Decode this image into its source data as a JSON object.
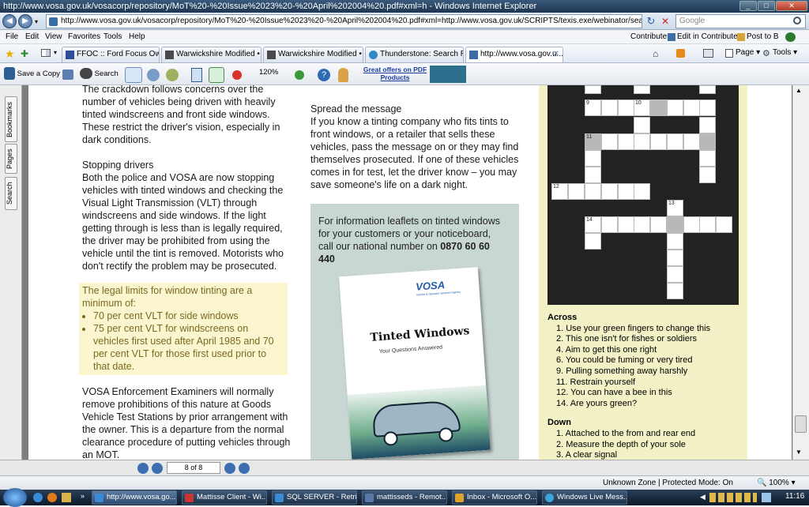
{
  "window": {
    "title": "http://www.vosa.gov.uk/vosacorp/repository/MoT%20-%20Issue%2023%20-%20April%202004%20.pdf#xml=h - Windows Internet Explorer",
    "min": "_",
    "max": "□",
    "close": "✕"
  },
  "address": {
    "url": "http://www.vosa.gov.uk/vosacorp/repository/MoT%20-%20Issue%2023%20-%20April%202004%20.pdf#xml=http://www.vosa.gov.uk/SCRIPTS/texis.exe/webinator/search/xml.txt?query=tints&p",
    "search_placeholder": "Google",
    "back": "◀",
    "forward": "▶",
    "refresh": "↻",
    "stop": "✕"
  },
  "menu": {
    "items": [
      "File",
      "Edit",
      "View",
      "Favorites",
      "Tools",
      "Help"
    ],
    "right": [
      "Contribute",
      "Edit in Contribute",
      "Post to Blo"
    ]
  },
  "tabs": [
    {
      "label": "FFOC :: Ford Focus Owner..."
    },
    {
      "label": "Warwickshire Modified • V..."
    },
    {
      "label": "Warwickshire Modified • V..."
    },
    {
      "label": "Thunderstone: Search Res..."
    },
    {
      "label": "http://www.vosa.gov.u..."
    }
  ],
  "tab_close": "✕",
  "cmd": {
    "page": "Page ▾",
    "tools": "Tools ▾"
  },
  "pdf_toolbar": {
    "save": "Save a Copy",
    "search": "Search",
    "zoom": "120%",
    "offer": "Great offers on PDF Products"
  },
  "left_tabs": [
    "Bookmarks",
    "Pages",
    "Search"
  ],
  "col1": {
    "p1": "The crackdown follows concerns over the number of vehicles being driven with heavily tinted windscreens and front side windows. These restrict the driver's vision, especially in dark conditions.",
    "h2": "Stopping drivers",
    "p2": "Both the police and VOSA are now stopping vehicles with tinted windows and checking the Visual Light Transmission (VLT) through windscreens and side windows. If the light getting through is less than is legally required, the driver may be prohibited from using the vehicle until the tint is removed. Motorists who don't rectify the problem may be prosecuted.",
    "legal_intro": "The legal limits for window tinting are a minimum of:",
    "legal_items": [
      "70 per cent VLT for side windows",
      "75 per cent VLT for windscreens on vehicles first used after April 1985 and 70 per cent VLT for those first used prior to that date."
    ],
    "p3": "VOSA Enforcement Examiners will normally remove prohibitions of this nature at Goods Vehicle Test Stations by prior arrangement with the owner. This is a departure from the normal clearance procedure of putting vehicles through an MOT."
  },
  "col2": {
    "h": "Spread the message",
    "p": "If you know a tinting company who fits tints to front windows, or a retailer that sells these vehicles, pass the message on or they may find themselves prosecuted. If one of these vehicles comes in for test, let the driver know – you may save someone's life on a dark night.",
    "info": "For information leaflets on tinted windows for your customers or your noticeboard, call our national number on",
    "phone": "0870 60 60 440",
    "leaflet_brand": "VOSA",
    "leaflet_brand_sub": "Vehicle & Operator Services Agency",
    "leaflet_title": "Tinted Windows",
    "leaflet_sub": "Your Questions Answered"
  },
  "col3": {
    "across_h": "Across",
    "across": [
      "1. Use your green fingers to change this",
      "2. This one isn't for fishes or soldiers",
      "4. Aim to get this one right",
      "6. You could be fuming or very tired",
      "9. Pulling something away harshly",
      "11. Restrain yourself",
      "12. You can have a bee in this",
      "14. Are yours green?"
    ],
    "down_h": "Down",
    "down": [
      "1. Attached to the from and rear end",
      "2. Measure the depth of your sole",
      "3. A clear signal"
    ],
    "clue_nums": {
      "n9": "9",
      "n10": "10",
      "n11": "11",
      "n12": "12",
      "n13": "13",
      "n14": "14"
    }
  },
  "pager": {
    "text": "8 of 8"
  },
  "status": {
    "zone": "Unknown Zone | Protected Mode: On",
    "zoom": "100%"
  },
  "taskbar": {
    "items": [
      "http://www.vosa.go...",
      "Mattisse Client - Wi...",
      "SQL SERVER - Retrie...",
      "mattisseds - Remot...",
      "Inbox - Microsoft O...",
      "Windows Live Mess..."
    ],
    "clock": "11:16"
  }
}
